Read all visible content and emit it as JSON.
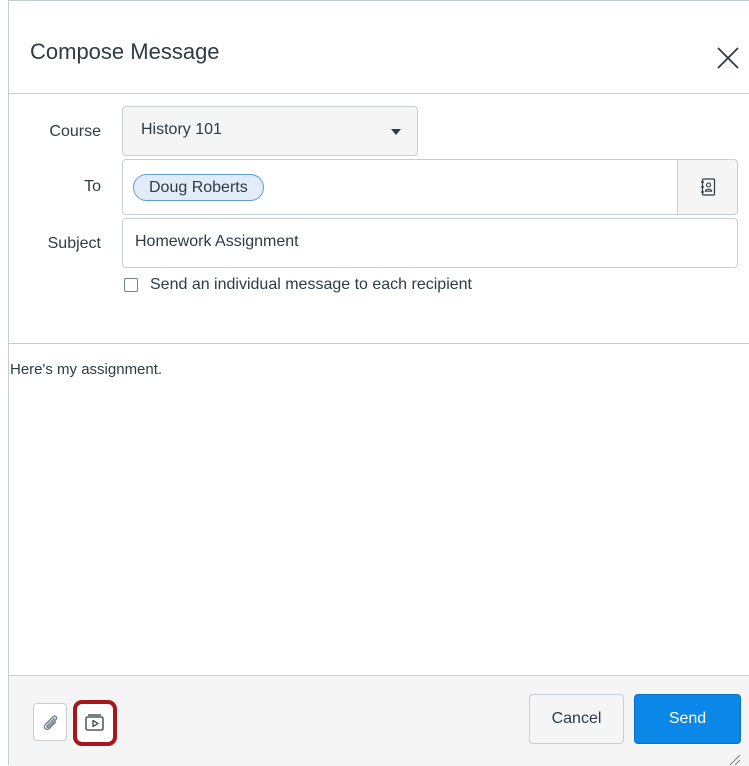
{
  "dialog": {
    "title": "Compose Message",
    "close_icon": "close-icon"
  },
  "form": {
    "course_label": "Course",
    "course_value": "History 101",
    "to_label": "To",
    "recipients": [
      "Doug Roberts"
    ],
    "address_book_icon": "address-book-icon",
    "subject_label": "Subject",
    "subject_value": "Homework Assignment",
    "individual_message_label": "Send an individual message to each recipient",
    "individual_message_checked": false
  },
  "message": {
    "body": "Here's my assignment."
  },
  "footer": {
    "attach_icon": "paperclip-icon",
    "media_icon": "media-icon",
    "media_highlighted": true,
    "cancel_label": "Cancel",
    "send_label": "Send"
  },
  "colors": {
    "primary": "#0b87e8",
    "highlight": "#a5161d",
    "pill_bg": "#e1ecf8",
    "pill_border": "#5a9fd6"
  }
}
